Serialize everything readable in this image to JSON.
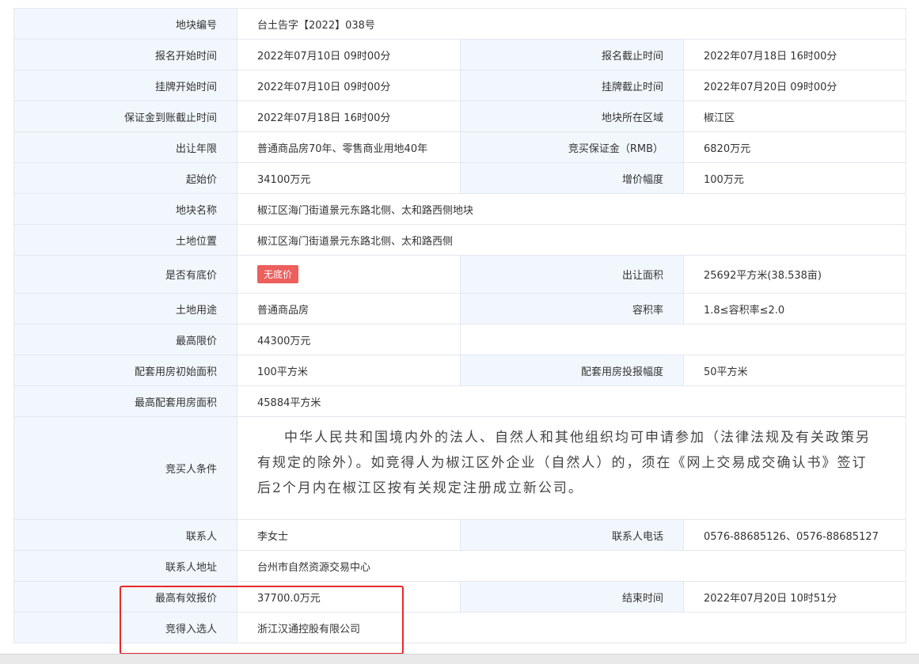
{
  "rows": {
    "plot_no": {
      "label": "地块编号",
      "value": "台土告字【2022】038号"
    },
    "reg_start": {
      "label": "报名开始时间",
      "value": "2022年07月10日 09时00分"
    },
    "reg_end": {
      "label": "报名截止时间",
      "value": "2022年07月18日 16时00分"
    },
    "list_start": {
      "label": "挂牌开始时间",
      "value": "2022年07月10日 09时00分"
    },
    "list_end": {
      "label": "挂牌截止时间",
      "value": "2022年07月20日 09时00分"
    },
    "deposit_deadline": {
      "label": "保证金到账截止时间",
      "value": "2022年07月18日 16时00分"
    },
    "district": {
      "label": "地块所在区域",
      "value": "椒江区"
    },
    "term": {
      "label": "出让年限",
      "value": "普通商品房70年、零售商业用地40年"
    },
    "deposit": {
      "label": "竞买保证金（RMB）",
      "value": "6820万元"
    },
    "start_price": {
      "label": "起始价",
      "value": "34100万元"
    },
    "increment": {
      "label": "增价幅度",
      "value": "100万元"
    },
    "plot_name": {
      "label": "地块名称",
      "value": "椒江区海门街道景元东路北侧、太和路西侧地块"
    },
    "location": {
      "label": "土地位置",
      "value": "椒江区海门街道景元东路北侧、太和路西侧"
    },
    "reserve": {
      "label": "是否有底价",
      "value": "无底价"
    },
    "area": {
      "label": "出让面积",
      "value": "25692平方米(38.538亩)"
    },
    "usage": {
      "label": "土地用途",
      "value": "普通商品房"
    },
    "far": {
      "label": "容积率",
      "value": "1.8≤容积率≤2.0"
    },
    "max_price": {
      "label": "最高限价",
      "value": "44300万元"
    },
    "support_init": {
      "label": "配套用房初始面积",
      "value": "100平方米"
    },
    "support_step": {
      "label": "配套用房投报幅度",
      "value": "50平方米"
    },
    "support_max": {
      "label": "最高配套用房面积",
      "value": "45884平方米"
    },
    "conditions": {
      "label": "竞买人条件",
      "value": "中华人民共和国境内外的法人、自然人和其他组织均可申请参加（法律法规及有关政策另有规定的除外）。如竞得人为椒江区外企业（自然人）的，须在《网上交易成交确认书》签订后2个月内在椒江区按有关规定注册成立新公司。"
    },
    "contact": {
      "label": "联系人",
      "value": "李女士"
    },
    "phone": {
      "label": "联系人电话",
      "value": "0576-88685126、0576-88685127"
    },
    "address": {
      "label": "联系人地址",
      "value": "台州市自然资源交易中心"
    },
    "top_bid": {
      "label": "最高有效报价",
      "value": "37700.0万元"
    },
    "end_time": {
      "label": "结束时间",
      "value": "2022年07月20日 10时51分"
    },
    "winner": {
      "label": "竞得入选人",
      "value": "浙江汉通控股有限公司"
    }
  },
  "colors": {
    "label_bg": "#f2f7fd",
    "border": "#e3e8ef",
    "badge": "#ec5f5d",
    "highlight": "#e8282b"
  }
}
